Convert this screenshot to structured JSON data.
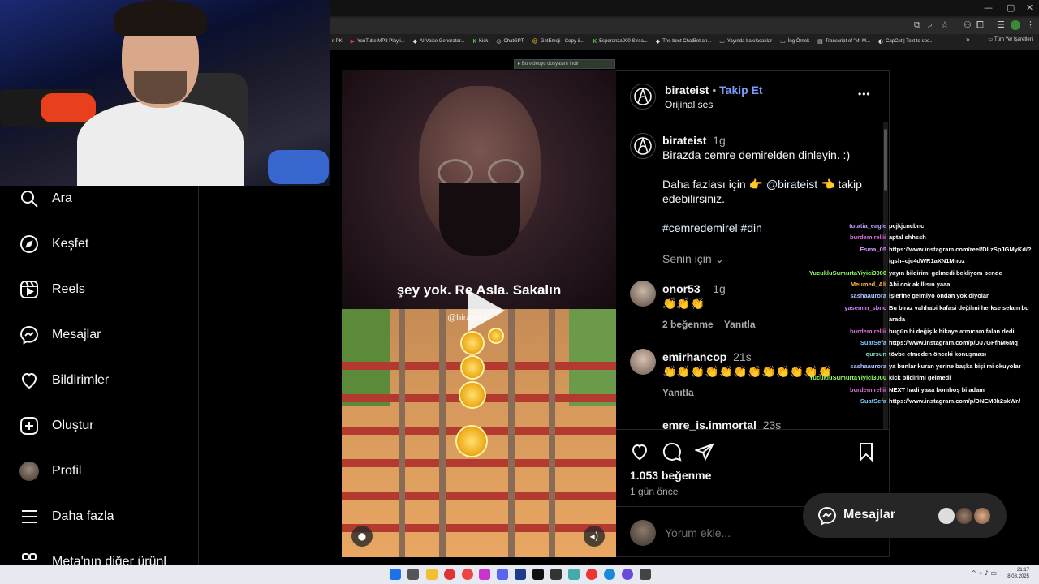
{
  "bookmarks": [
    {
      "icon": "",
      "label": "s PK"
    },
    {
      "icon": "▶",
      "label": "YouTube MP3 Playli..."
    },
    {
      "icon": "◆",
      "label": "AI Voice Generator..."
    },
    {
      "icon": "K",
      "label": "Kick"
    },
    {
      "icon": "◎",
      "label": "ChatGPT"
    },
    {
      "icon": "☺",
      "label": "GetEmoji - Copy &..."
    },
    {
      "icon": "K",
      "label": "Esperanza000 Strea..."
    },
    {
      "icon": "◆",
      "label": "The best ChatBot an..."
    },
    {
      "icon": "▭",
      "label": "Yayında bakılacaklar"
    },
    {
      "icon": "▭",
      "label": "İng Örnek"
    },
    {
      "icon": "▤",
      "label": "Transcript of \"MI M..."
    },
    {
      "icon": "◐",
      "label": "CapCut | Text to spe..."
    }
  ],
  "bookmarks_more": "»",
  "all_bookmarks": "Tüm Yer İşaretleri",
  "download_badge": "Bu videoyu dosyasını indir",
  "sidebar": {
    "items": [
      {
        "icon": "search-icon",
        "label": "Ara"
      },
      {
        "icon": "compass-icon",
        "label": "Keşfet"
      },
      {
        "icon": "reels-icon",
        "label": "Reels"
      },
      {
        "icon": "messenger-icon",
        "label": "Mesajlar"
      },
      {
        "icon": "heart-icon",
        "label": "Bildirimler"
      },
      {
        "icon": "plus-square-icon",
        "label": "Oluştur"
      },
      {
        "icon": "avatar",
        "label": "Profil"
      },
      {
        "icon": "menu-icon",
        "label": "Daha fazla"
      },
      {
        "icon": "meta-icon",
        "label": "Meta'nın diğer ürünl"
      }
    ]
  },
  "video": {
    "caption": "şey yok. Re   Asla. Sakalın",
    "watermark": "@birateist"
  },
  "post": {
    "username": "birateist",
    "follow": "Takip Et",
    "audio": "Orijinal ses",
    "more": "•••",
    "caption_user": "birateist",
    "caption_time": "1g",
    "caption_line1": "Birazda cemre demirelden dinleyin. :)",
    "caption_line2a": "Daha fazlası için 👉",
    "caption_mention": "@birateist",
    "caption_line2b": "👈 takip",
    "caption_line3": "edebilirsiniz.",
    "caption_tags": "#cemredemirel #din",
    "senin_icin": "Senin için",
    "comments": [
      {
        "user": "onor53_",
        "time": "1g",
        "text": "👏👏👏",
        "likes": "2 beğenme",
        "reply": "Yanıtla"
      },
      {
        "user": "emirhancop",
        "time": "21s",
        "text": "👏👏👏👏👏👏👏👏👏👏👏👏",
        "likes": "",
        "reply": "Yanıtla"
      },
      {
        "user": "emre_is.immortal",
        "time": "23s",
        "text": "",
        "likes": "",
        "reply": ""
      }
    ],
    "likes_count": "1.053 beğenme",
    "posted": "1 gün önce",
    "comment_placeholder": "Yorum ekle..."
  },
  "chat": [
    {
      "name": "tutatia_eagle",
      "color": "#b8a0ff",
      "msg": "pcjkjcncbnc"
    },
    {
      "name": "burdemirellii",
      "color": "#e070e0",
      "msg": "aptal shhssh"
    },
    {
      "name": "Esma_05",
      "color": "#d090ff",
      "msg": "https://www.instagram.com/reel/DLzSpJGMyKd/?"
    },
    {
      "name": "",
      "color": "#ffffff",
      "msg": "igsh=cjc4dWR1aXN1Mnoz"
    },
    {
      "name": "YucukluSumurtaYiyici3000",
      "color": "#8fff60",
      "msg": "yayın bildirimi gelmedi bekliyom bende"
    },
    {
      "name": "Meumed_Ali",
      "color": "#ffb347",
      "msg": "Abi cok akıllısın yaaa"
    },
    {
      "name": "sashaaurora",
      "color": "#b0c4ff",
      "msg": "işlerine gelmiyo ondan yok diyolar"
    },
    {
      "name": "yasemin_sbnc",
      "color": "#d580ff",
      "msg": "Bu biraz vahhabi kafasi değilmi herkse selam bu"
    },
    {
      "name": "",
      "color": "#ffffff",
      "msg": "arada"
    },
    {
      "name": "burdemirellii",
      "color": "#e070e0",
      "msg": "bugün bi değişik hikaye atmıcam falan dedi"
    },
    {
      "name": "SuatSefa",
      "color": "#7fd0ff",
      "msg": "https://www.instagram.com/p/DJ7GFfhM6Mq"
    },
    {
      "name": "qursun",
      "color": "#80e0c0",
      "msg": "tövbe etmeden önceki konuşması"
    },
    {
      "name": "sashaaurora",
      "color": "#b0c4ff",
      "msg": "ya bunlar kuran yerine başka bişi mi okuyolar"
    },
    {
      "name": "YucukluSumurtaYiyici3000",
      "color": "#8fff60",
      "msg": "kick bildirimi gelmedi"
    },
    {
      "name": "burdemirellii",
      "color": "#e070e0",
      "msg": "NEXT hadi yaaa bomboş bi adam"
    },
    {
      "name": "SuatSefa",
      "color": "#7fd0ff",
      "msg": "https://www.instagram.com/p/DNEM8k2skWr/"
    }
  ],
  "messages_pill": {
    "label": "Mesajlar"
  },
  "clock": {
    "time": "21:17",
    "date": "8.08.2025"
  },
  "colors": {
    "accent": "#0095f6",
    "follow": "#7b9cff",
    "link": "#e0f1ff"
  }
}
